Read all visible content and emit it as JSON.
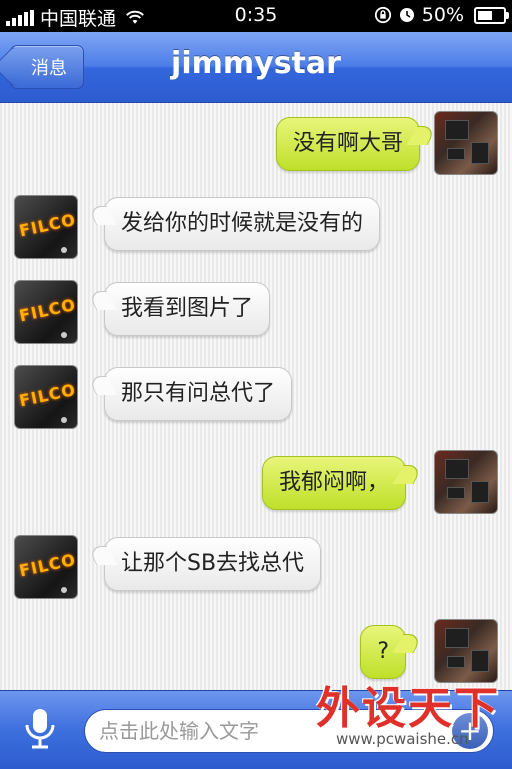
{
  "status_bar": {
    "carrier": "中国联通",
    "time": "0:35",
    "battery": "50%"
  },
  "nav": {
    "back_label": "消息",
    "title": "jimmystar"
  },
  "messages": [
    {
      "side": "out",
      "text": "没有啊大哥"
    },
    {
      "side": "in",
      "text": "发给你的时候就是没有的"
    },
    {
      "side": "in",
      "text": "我看到图片了"
    },
    {
      "side": "in",
      "text": "那只有问总代了"
    },
    {
      "side": "out",
      "text": "我郁闷啊，"
    },
    {
      "side": "in",
      "text": "让那个SB去找总代"
    },
    {
      "side": "out",
      "text": "?"
    }
  ],
  "input": {
    "placeholder": "点击此处输入文字"
  },
  "avatars": {
    "contact_logo_text": "FILCO"
  },
  "watermark": {
    "title": "外设天下",
    "url": "www.pcwaishe.cn"
  },
  "colors": {
    "nav_blue": "#3b6ad6",
    "out_bubble": "#d4ec4a",
    "in_bubble": "#ffffff"
  }
}
